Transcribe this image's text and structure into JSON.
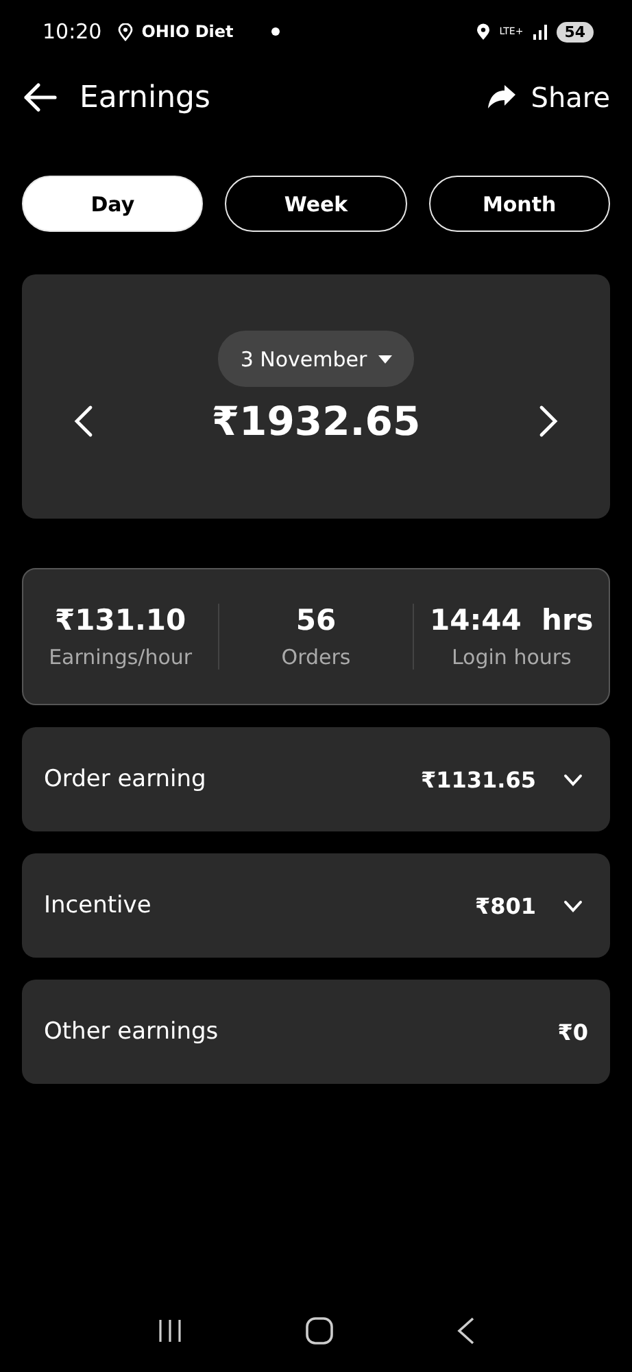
{
  "status_bar": {
    "time": "10:20",
    "notification": "OHIO Diet",
    "network": "LTE+",
    "battery": "54"
  },
  "header": {
    "title": "Earnings",
    "share": "Share"
  },
  "tabs": [
    {
      "label": "Day",
      "selected": true
    },
    {
      "label": "Week",
      "selected": false
    },
    {
      "label": "Month",
      "selected": false
    }
  ],
  "date_card": {
    "date": "3 November",
    "total": "₹1932.65"
  },
  "stats": [
    {
      "value": "₹131.10",
      "label": "Earnings/hour"
    },
    {
      "value": "56",
      "label": "Orders"
    },
    {
      "value": "14:44  hrs",
      "label": "Login hours"
    }
  ],
  "rows": [
    {
      "label": "Order earning",
      "amount": "₹1131.65",
      "kind": "expandable"
    },
    {
      "label": "Incentive",
      "amount": "₹801",
      "kind": "expandable"
    },
    {
      "label": "Other earnings",
      "amount": "₹0",
      "kind": "plain"
    }
  ]
}
